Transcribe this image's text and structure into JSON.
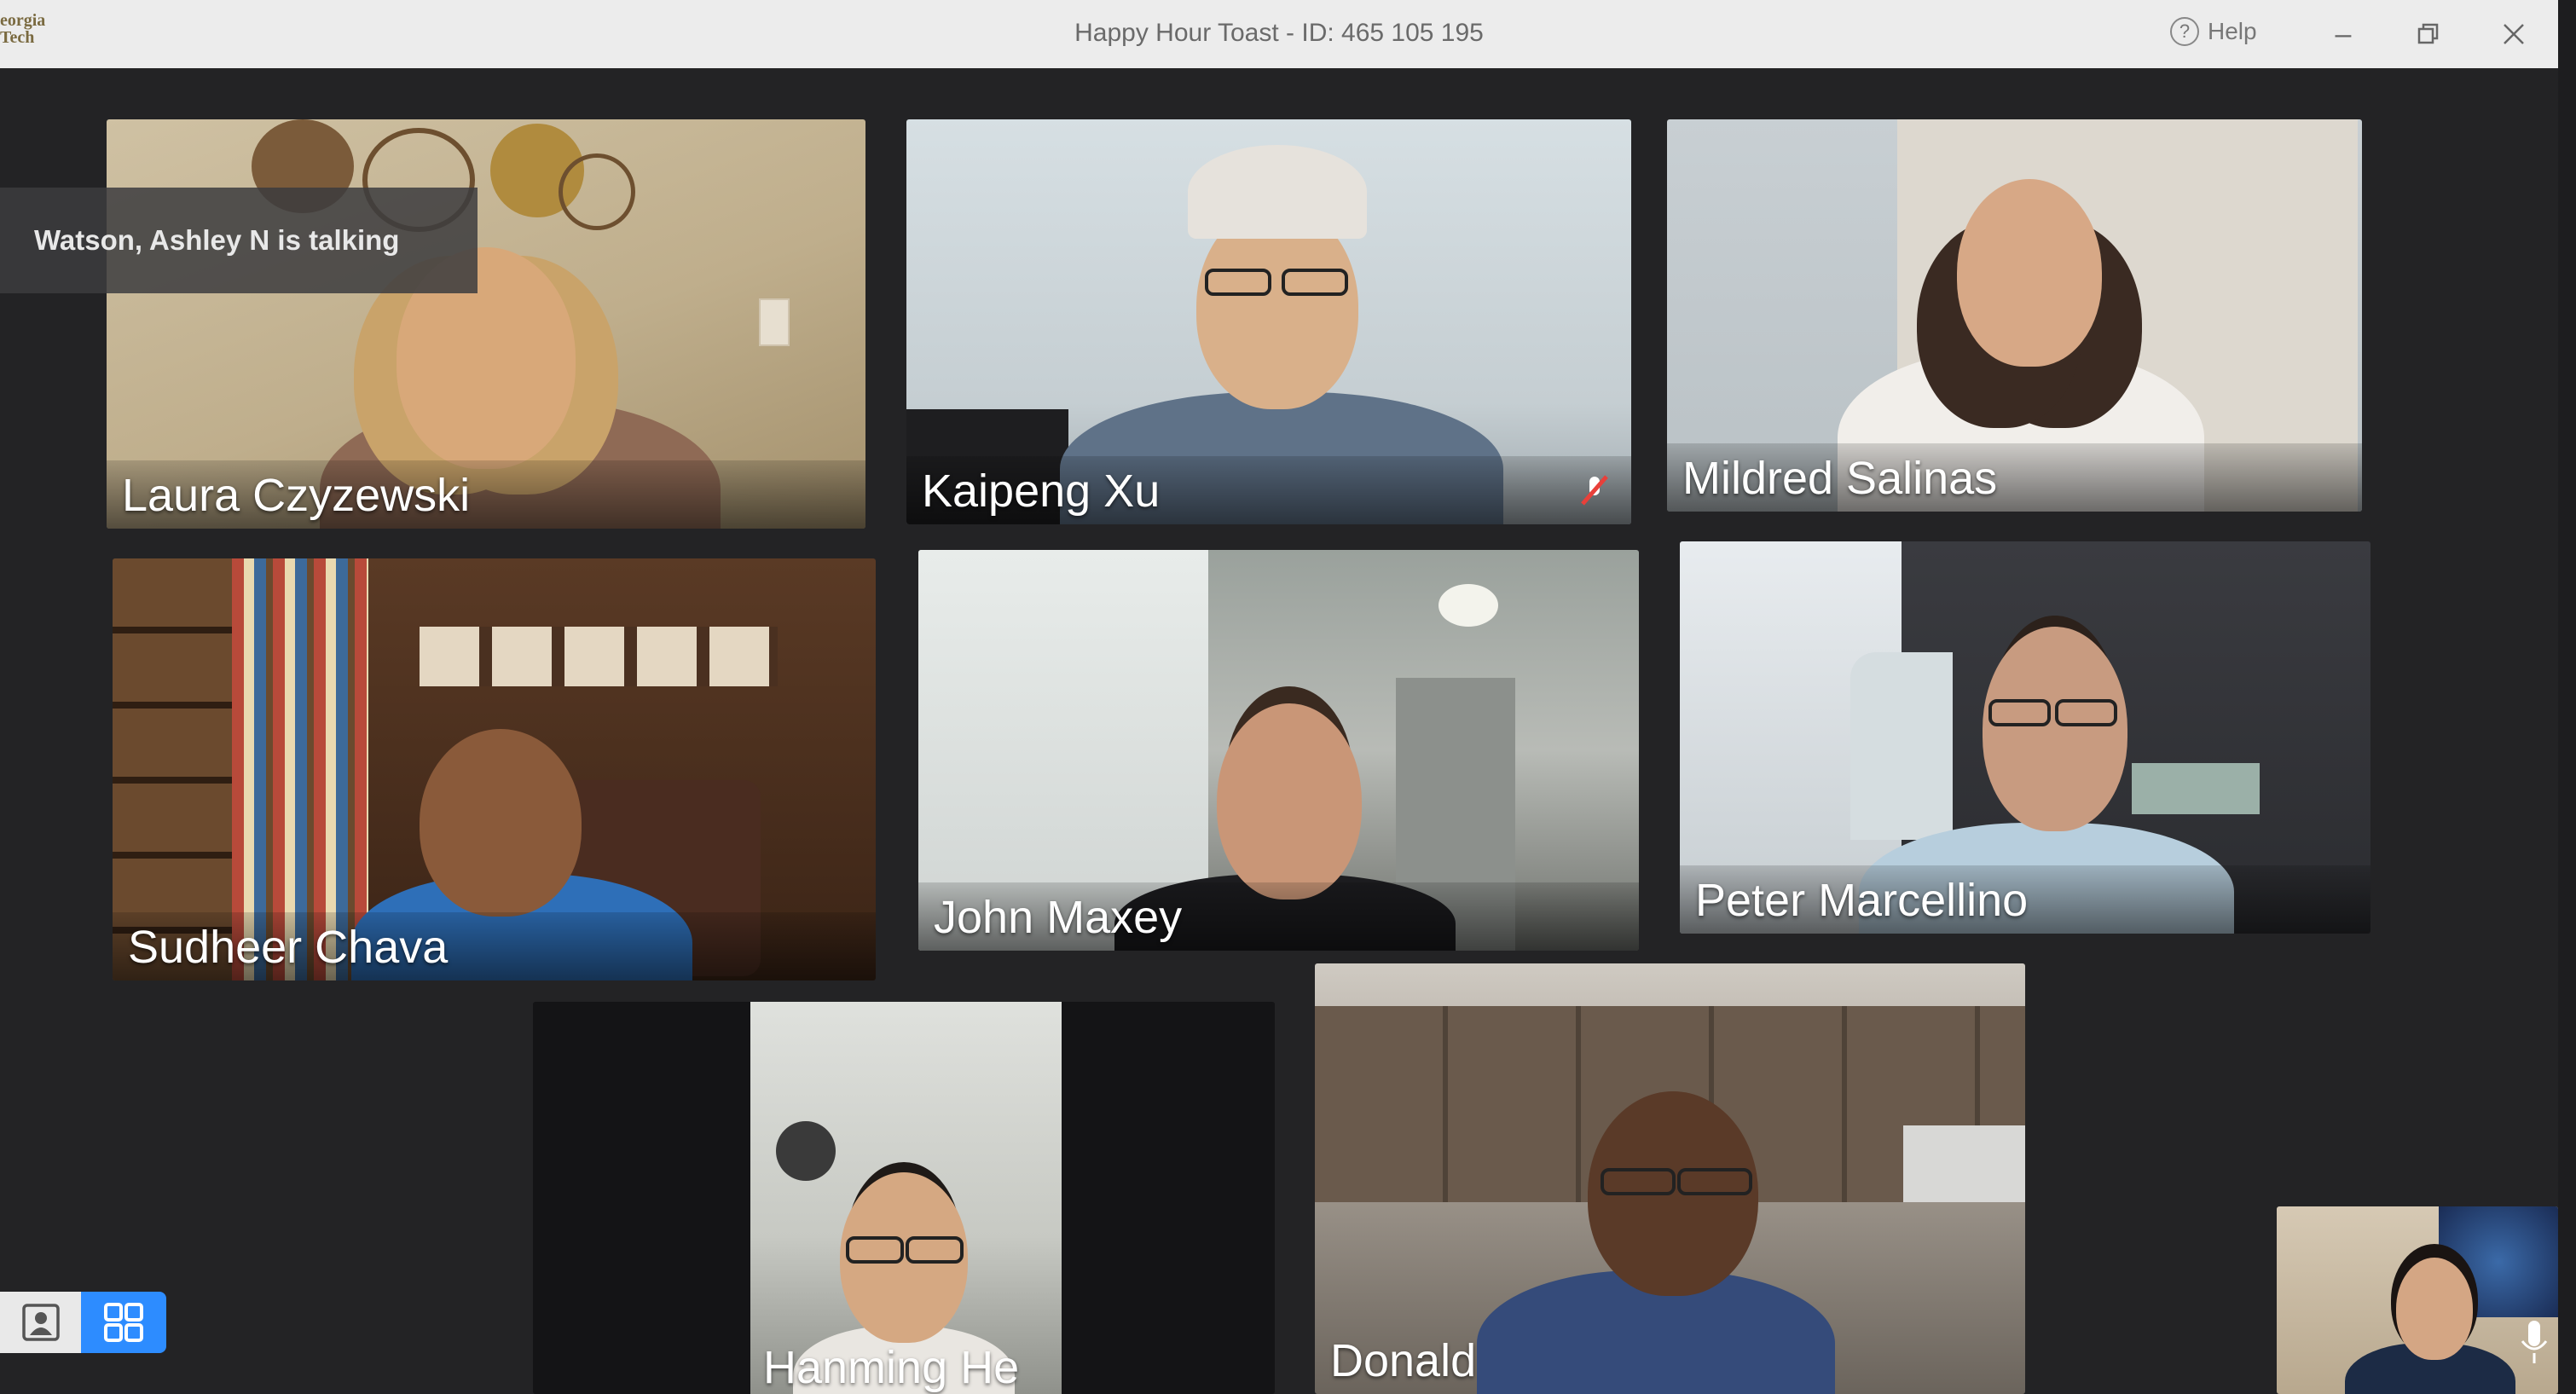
{
  "window": {
    "logo_text": "eorgia\nTech",
    "title": "Happy Hour Toast - ID: 465 105 195",
    "help_label": "Help"
  },
  "colors": {
    "titlebar": "#ececec",
    "stage": "#232325",
    "gallery_active": "#2d8cff",
    "muted_red": "#e8403a"
  },
  "status": {
    "talking": "Watson, Ashley N is talking"
  },
  "participants": [
    {
      "name": "Laura Czyzewski",
      "muted": false
    },
    {
      "name": "Kaipeng Xu",
      "muted": true
    },
    {
      "name": "Mildred Salinas",
      "muted": false
    },
    {
      "name": "Sudheer Chava",
      "muted": false
    },
    {
      "name": "John Maxey",
      "muted": false
    },
    {
      "name": "Peter Marcellino",
      "muted": false
    },
    {
      "name": "Hanming He",
      "muted": false
    },
    {
      "name": "Donald",
      "muted": false
    },
    {
      "name": "",
      "muted": false
    }
  ],
  "view_switch": {
    "speaker_icon": "speaker-view-icon",
    "gallery_icon": "gallery-view-icon",
    "active": "gallery"
  }
}
